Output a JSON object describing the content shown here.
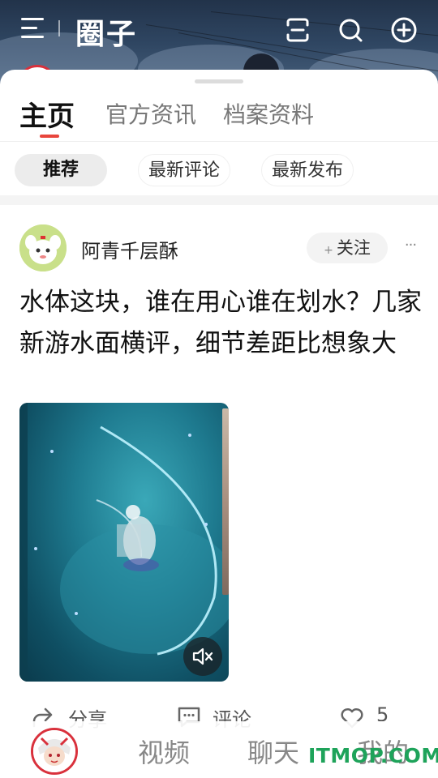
{
  "header": {
    "title": "圈子",
    "icons": [
      "menu-icon",
      "scan-icon",
      "search-icon",
      "add-icon"
    ]
  },
  "tabs": {
    "main": [
      {
        "label": "主页",
        "active": true
      },
      {
        "label": "官方资讯",
        "active": false
      },
      {
        "label": "档案资料",
        "active": false
      }
    ],
    "sub": [
      {
        "label": "推荐",
        "active": true
      },
      {
        "label": "最新评论",
        "active": false
      },
      {
        "label": "最新发布",
        "active": false
      }
    ]
  },
  "post": {
    "author": "阿青千层酥",
    "follow_label": "关注",
    "more_label": "···",
    "title": "水体这块，谁在用心谁在划水？几家新游水面横评，细节差距比想象大",
    "actions": {
      "share": "分享",
      "comment": "评论",
      "like_count": "5"
    }
  },
  "bottom_nav": {
    "items": [
      "视频",
      "聊天",
      "我的"
    ]
  },
  "watermark": "ITMOP.COM",
  "colors": {
    "accent": "#e8453c",
    "watermark": "#1ea35a",
    "header_bg": "#2f4662"
  }
}
